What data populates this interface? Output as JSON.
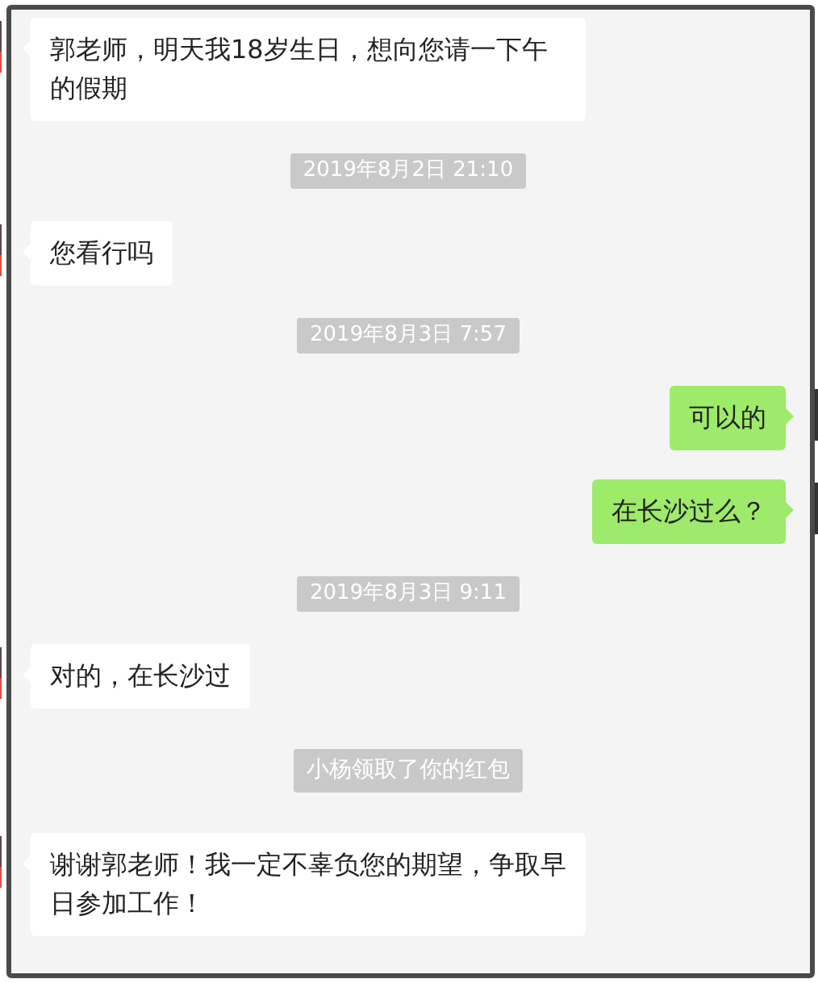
{
  "messages": [
    {
      "kind": "received",
      "text": "郭老师，明天我18岁生日，想向您请一下午的假期"
    },
    {
      "kind": "time",
      "text": "2019年8月2日 21:10"
    },
    {
      "kind": "received",
      "text": "您看行吗"
    },
    {
      "kind": "time",
      "text": "2019年8月3日 7:57"
    },
    {
      "kind": "sent",
      "text": "可以的"
    },
    {
      "kind": "sent",
      "text": "在长沙过么？"
    },
    {
      "kind": "time",
      "text": "2019年8月3日 9:11"
    },
    {
      "kind": "received",
      "text": "对的，在长沙过"
    },
    {
      "kind": "system",
      "text": "小杨领取了你的红包"
    },
    {
      "kind": "received",
      "text": "谢谢郭老师！我一定不辜负您的期望，争取早日参加工作！"
    }
  ]
}
